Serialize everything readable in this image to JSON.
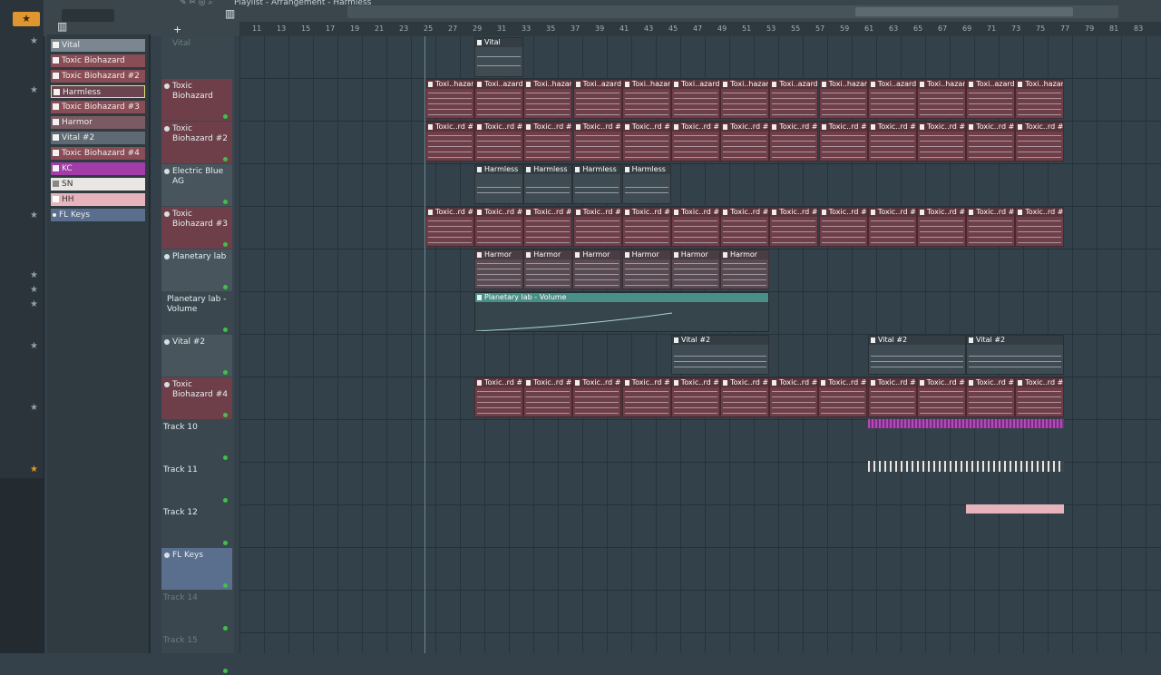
{
  "toolbar": {
    "breadcrumb": "Playlist - Arrangement - Harmless"
  },
  "ruler": {
    "numbers": [
      "11",
      "13",
      "15",
      "17",
      "19",
      "21",
      "23",
      "25",
      "27",
      "29",
      "31",
      "33",
      "35",
      "37",
      "39",
      "41",
      "43",
      "45",
      "47",
      "49",
      "51",
      "53",
      "55",
      "57",
      "59",
      "61",
      "63",
      "65",
      "67",
      "69",
      "71",
      "73",
      "75",
      "77",
      "79",
      "81",
      "83"
    ]
  },
  "picker": {
    "items": [
      {
        "label": "Vital",
        "color": "#7a8791"
      },
      {
        "label": "Toxic Biohazard",
        "color": "#8a4c55"
      },
      {
        "label": "Toxic Biohazard #2",
        "color": "#8a4c55"
      },
      {
        "label": "Harmless",
        "color": "#6b4450"
      },
      {
        "label": "Toxic Biohazard #3",
        "color": "#8a4c55"
      },
      {
        "label": "Harmor",
        "color": "#7b5a63"
      },
      {
        "label": "Vital #2",
        "color": "#5d6a73"
      },
      {
        "label": "Toxic Biohazard #4",
        "color": "#8a4c55"
      },
      {
        "label": "KC",
        "color": "#a13ca8"
      },
      {
        "label": "SN",
        "color": "#e9e6e3"
      },
      {
        "label": "HH",
        "color": "#e8b4bc"
      },
      {
        "label": "FL Keys",
        "color": "#5a6e8e"
      }
    ]
  },
  "tracks": [
    {
      "name": "Vital"
    },
    {
      "name": "Toxic Biohazard"
    },
    {
      "name": "Toxic Biohazard #2"
    },
    {
      "name": "Electric Blue AG"
    },
    {
      "name": "Toxic Biohazard #3"
    },
    {
      "name": "Planetary lab"
    },
    {
      "name": "Planetary lab - Volume"
    },
    {
      "name": "Vital #2"
    },
    {
      "name": "Toxic Biohazard #4"
    },
    {
      "name": "Track 10"
    },
    {
      "name": "Track 11"
    },
    {
      "name": "Track 12"
    },
    {
      "name": "FL Keys"
    },
    {
      "name": "Track 14"
    },
    {
      "name": "Track 15"
    }
  ],
  "clips": {
    "vital": "Vital",
    "tb1": "Toxi..hazard",
    "tb1b": "Toxi..azard",
    "tb2": "Toxic..rd #2",
    "harmless": "Harmless",
    "tb3": "Toxic..rd #3",
    "harmor": "Harmor",
    "auto": "Planetary lab - Volume",
    "vital2": "Vital #2",
    "tb4": "Toxic..rd #4"
  },
  "colors": {
    "clip_red": "#6e3f49",
    "clip_gray": "#5a6670",
    "auto_green": "#4a8f87",
    "kc": "#a13ca8",
    "hh": "#e8b4bc"
  }
}
